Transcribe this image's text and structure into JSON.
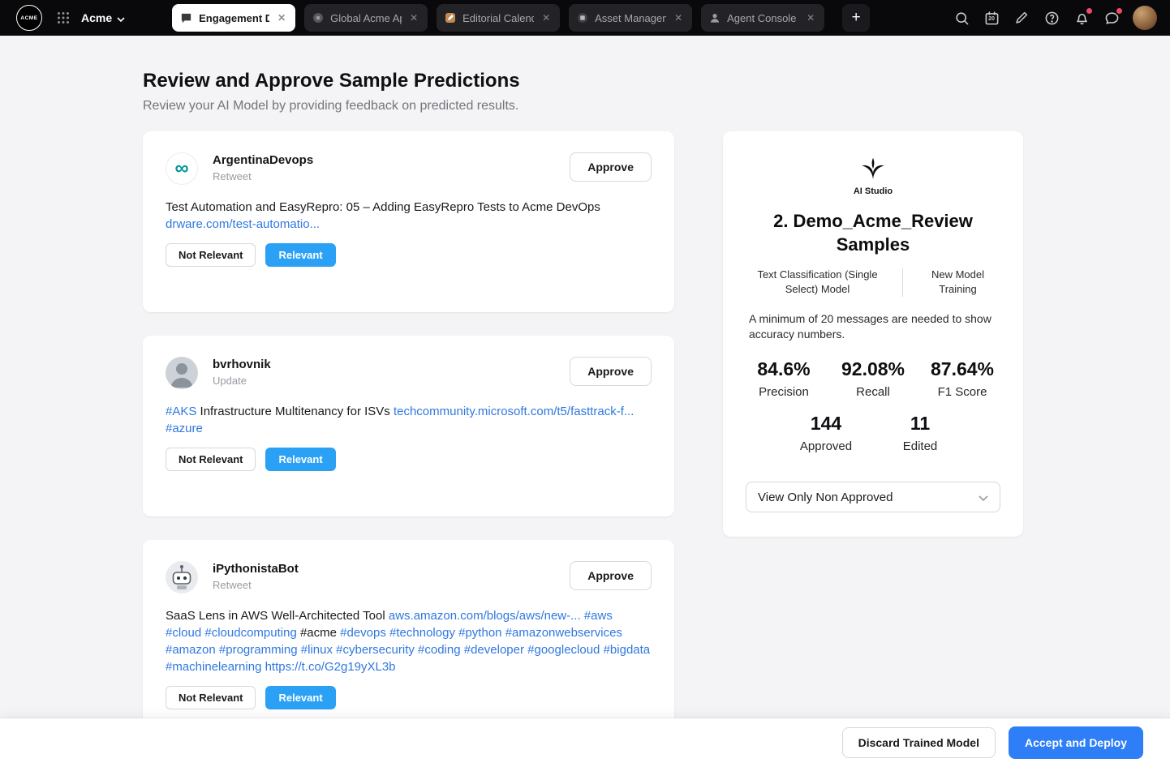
{
  "topbar": {
    "logo_text": "ACME",
    "workspace": "Acme",
    "tabs": [
      {
        "label": "Engagement D"
      },
      {
        "label": "Global Acme Ap"
      },
      {
        "label": "Editorial Calend"
      },
      {
        "label": "Asset Managem"
      },
      {
        "label": "Agent Console"
      }
    ],
    "calendar_day": "20"
  },
  "page": {
    "title": "Review and Approve Sample Predictions",
    "subtitle": "Review your AI Model by providing feedback on predicted results."
  },
  "actions": {
    "approve": "Approve",
    "not_relevant": "Not Relevant",
    "relevant": "Relevant"
  },
  "posts": [
    {
      "author": "ArgentinaDevops",
      "kind": "Retweet",
      "segments": [
        {
          "text": "Test Automation and EasyRepro: 05 – Adding EasyRepro Tests to Acme DevOps "
        },
        {
          "text": "drware.com/test-automatio...",
          "link": true
        }
      ]
    },
    {
      "author": "bvrhovnik",
      "kind": "Update",
      "segments": [
        {
          "text": "#AKS",
          "link": true
        },
        {
          "text": " Infrastructure Multitenancy for ISVs "
        },
        {
          "text": "techcommunity.microsoft.com/t5/fasttrack-f...",
          "link": true
        },
        {
          "text": " "
        },
        {
          "text": "#azure",
          "link": true
        }
      ]
    },
    {
      "author": "iPythonistaBot",
      "kind": "Retweet",
      "segments": [
        {
          "text": "SaaS Lens in AWS Well-Architected Tool "
        },
        {
          "text": "aws.amazon.com/blogs/aws/new-...",
          "link": true
        },
        {
          "text": " "
        },
        {
          "text": "#aws",
          "link": true
        },
        {
          "text": " "
        },
        {
          "text": "#cloud",
          "link": true
        },
        {
          "text": " "
        },
        {
          "text": "#cloudcomputing",
          "link": true
        },
        {
          "text": " #acme "
        },
        {
          "text": "#devops",
          "link": true
        },
        {
          "text": " "
        },
        {
          "text": "#technology",
          "link": true
        },
        {
          "text": " "
        },
        {
          "text": "#python",
          "link": true
        },
        {
          "text": " "
        },
        {
          "text": "#amazonwebservices",
          "link": true
        },
        {
          "text": " "
        },
        {
          "text": "#amazon",
          "link": true
        },
        {
          "text": " "
        },
        {
          "text": "#programming",
          "link": true
        },
        {
          "text": " "
        },
        {
          "text": "#linux",
          "link": true
        },
        {
          "text": " "
        },
        {
          "text": "#cybersecurity",
          "link": true
        },
        {
          "text": " "
        },
        {
          "text": "#coding",
          "link": true
        },
        {
          "text": " "
        },
        {
          "text": "#developer",
          "link": true
        },
        {
          "text": " "
        },
        {
          "text": "#googlecloud",
          "link": true
        },
        {
          "text": " "
        },
        {
          "text": "#bigdata",
          "link": true
        },
        {
          "text": " "
        },
        {
          "text": "#machinelearning",
          "link": true
        },
        {
          "text": " "
        },
        {
          "text": "https://t.co/G2g19yXL3b",
          "link": true
        }
      ]
    }
  ],
  "panel": {
    "brand": "AI Studio",
    "title": "2. Demo_Acme_Review Samples",
    "model_type": "Text Classification (Single Select) Model",
    "training_mode": "New Model Training",
    "note": "A minimum of 20 messages are needed to show accuracy numbers.",
    "metrics": [
      {
        "value": "84.6%",
        "label": "Precision"
      },
      {
        "value": "92.08%",
        "label": "Recall"
      },
      {
        "value": "87.64%",
        "label": "F1 Score"
      }
    ],
    "counts": [
      {
        "value": "144",
        "label": "Approved"
      },
      {
        "value": "11",
        "label": "Edited"
      }
    ],
    "filter": "View Only Non Approved"
  },
  "footer": {
    "discard": "Discard Trained Model",
    "accept": "Accept and Deploy"
  },
  "colors": {
    "accent_blue": "#2e7ef7",
    "relevant_blue": "#2ba1f6",
    "link_blue": "#2f78e0",
    "badge_red": "#ef4b66"
  }
}
